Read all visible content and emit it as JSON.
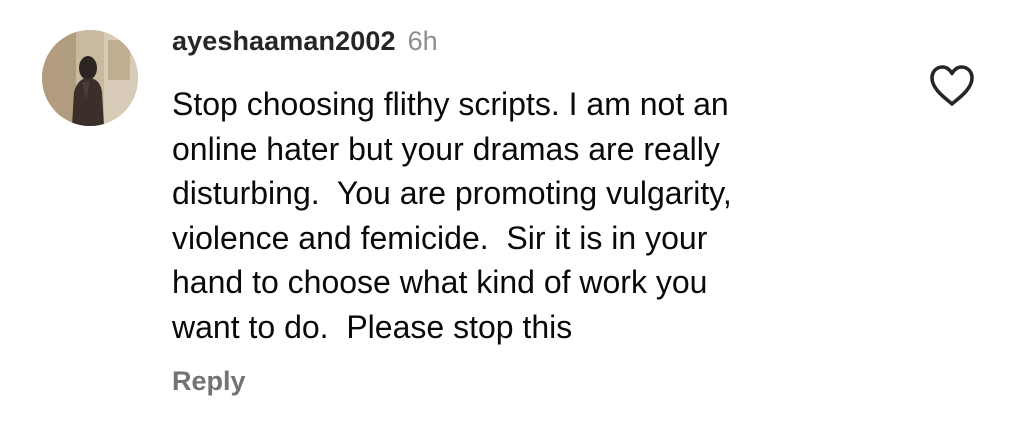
{
  "comment": {
    "username": "ayeshaaman2002",
    "time": "6h",
    "text": "Stop choosing flithy scripts. I am not an\nonline hater but your dramas are really\ndisturbing.  You are promoting vulgarity,\nviolence and femicide.  Sir it is in your\nhand to choose what kind of work you\nwant to do.  Please stop this",
    "reply_label": "Reply",
    "like_icon": "heart-outline-icon"
  },
  "colors": {
    "username": "#262626",
    "time": "#8e8e8e",
    "reply": "#737373",
    "heart_stroke": "#262626",
    "background": "#ffffff"
  }
}
